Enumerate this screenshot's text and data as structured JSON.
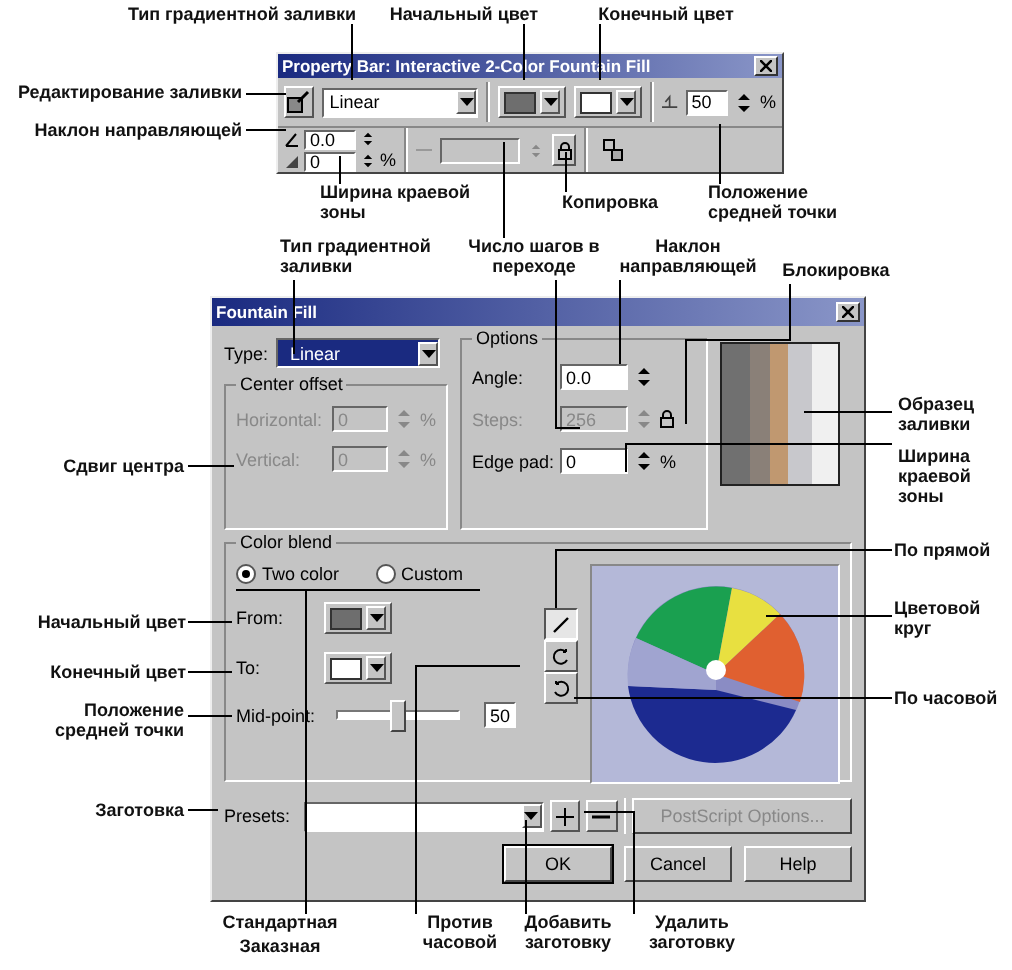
{
  "callouts": [
    "Тип градиентной заливки",
    "Начальный цвет",
    "Конечный цвет",
    "Редактирование заливки",
    "Наклон направляющей",
    "Ширина краевой зоны",
    "Копировка",
    "Положение средней точки",
    "Тип градиентной заливки",
    "Число шагов в переходе",
    "Наклон направляющей",
    "Блокировка",
    "Образец заливки",
    "Ширина краевой зоны",
    "По прямой",
    "Цветовой круг",
    "По часовой",
    "Сдвиг центра",
    "Начальный цвет",
    "Конечный цвет",
    "Положение средней точки",
    "Заготовка",
    "Стандартная",
    "Заказная",
    "Против часовой",
    "Добавить заготовку",
    "Удалить заготовку"
  ],
  "property_bar": {
    "title": "Property Bar: Interactive 2-Color Fountain Fill",
    "fill_type": "Linear",
    "start_color": {
      "color": "#6e6e6e"
    },
    "end_color": {
      "color": "#ffffff"
    },
    "midpoint": "50",
    "midpoint_unit": "%",
    "angle": "0.0",
    "edge_pad": "0",
    "edge_pad_unit": "%",
    "steps_disabled": true
  },
  "fountain_fill": {
    "title": "Fountain Fill",
    "type_label": "Type:",
    "type_value": "Linear",
    "center_offset": {
      "title": "Center offset",
      "disabled": true,
      "rows": [
        {
          "label": "Horizontal:",
          "value": "0",
          "unit": "%"
        },
        {
          "label": "Vertical:",
          "value": "0",
          "unit": "%"
        }
      ]
    },
    "options": {
      "title": "Options",
      "angle_label": "Angle:",
      "angle": "0.0",
      "steps_label": "Steps:",
      "steps": "256",
      "steps_disabled": true,
      "edge_pad_label": "Edge pad:",
      "edge_pad": "0",
      "edge_pad_unit": "%"
    },
    "color_blend": {
      "title": "Color blend",
      "modes": [
        {
          "label": "Two color",
          "selected": true
        },
        {
          "label": "Custom",
          "selected": false
        }
      ],
      "from_label": "From:",
      "from": {
        "color": "#6e6e6e"
      },
      "to_label": "To:",
      "to": {
        "color": "#ffffff"
      },
      "midpoint_label": "Mid-point:",
      "midpoint": {
        "level": 0.5,
        "value": "50"
      },
      "directions": [
        {
          "kind": "straight",
          "selected": true
        },
        {
          "kind": "counterclockwise",
          "selected": false
        },
        {
          "kind": "clockwise",
          "selected": false
        }
      ]
    },
    "presets_label": "Presets:",
    "postscript_button": "PostScript Options...",
    "buttons": [
      "OK",
      "Cancel",
      "Help"
    ]
  }
}
